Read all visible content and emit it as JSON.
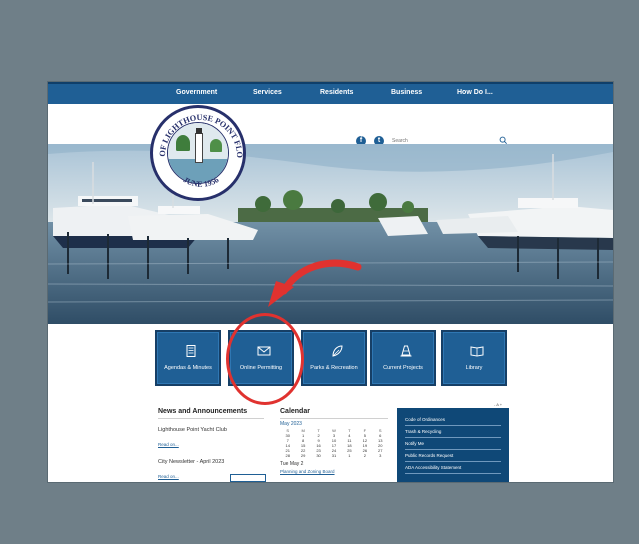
{
  "nav": {
    "items": [
      "Government",
      "Services",
      "Residents",
      "Business",
      "How Do I..."
    ]
  },
  "header": {
    "seal_top_text": "CITY OF LIGHTHOUSE POINT FLORIDA",
    "seal_bottom_text": "JUNE 1956",
    "social_icons": [
      "facebook-icon",
      "twitter-icon"
    ],
    "search_placeholder": "Search"
  },
  "tiles": [
    {
      "label": "Agendas & Minutes",
      "icon": "document-icon"
    },
    {
      "label": "Online Permitting",
      "icon": "envelope-icon"
    },
    {
      "label": "Parks & Recreation",
      "icon": "leaf-icon"
    },
    {
      "label": "Current Projects",
      "icon": "traffic-cone-icon"
    },
    {
      "label": "Library",
      "icon": "book-icon"
    }
  ],
  "news": {
    "heading": "News and Announcements",
    "items": [
      {
        "title": "Lighthouse Point Yacht Club",
        "link": "Read on..."
      },
      {
        "title": "City Newsletter - April 2023",
        "link": "Read on..."
      }
    ]
  },
  "calendar": {
    "heading": "Calendar",
    "month": "May 2023",
    "weekdays": [
      "S",
      "M",
      "T",
      "W",
      "T",
      "F",
      "S"
    ],
    "weeks": [
      [
        "30",
        "1",
        "2",
        "3",
        "4",
        "5",
        "6"
      ],
      [
        "7",
        "8",
        "9",
        "10",
        "11",
        "12",
        "13"
      ],
      [
        "14",
        "15",
        "16",
        "17",
        "18",
        "19",
        "20"
      ],
      [
        "21",
        "22",
        "23",
        "24",
        "25",
        "26",
        "27"
      ],
      [
        "28",
        "29",
        "30",
        "31",
        "1",
        "2",
        "3"
      ]
    ],
    "selected_date": "Tue May 2",
    "event": "Planning and Zoning Board"
  },
  "quicklinks": {
    "items": [
      "Code of Ordinances",
      "Trash & Recycling",
      "Notify Me",
      "Public Records Request",
      "ADA Accessibility Statement"
    ]
  },
  "font_control": "- A +",
  "colors": {
    "page_background": "#6f7f88",
    "brand_blue": "#1f5f95",
    "dark_blue": "#0f4877",
    "highlight_red": "#e0322f"
  }
}
